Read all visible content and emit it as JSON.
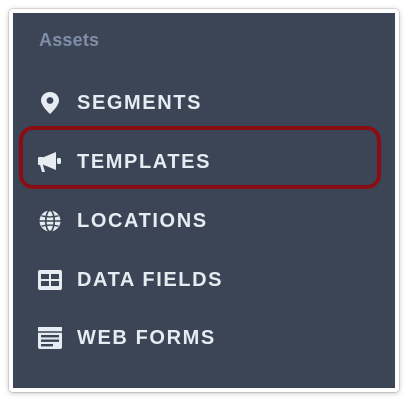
{
  "sidebar": {
    "section_title": "Assets",
    "items": [
      {
        "label": "SEGMENTS",
        "icon": "map-pin-icon"
      },
      {
        "label": "TEMPLATES",
        "icon": "megaphone-icon"
      },
      {
        "label": "LOCATIONS",
        "icon": "globe-icon"
      },
      {
        "label": "DATA FIELDS",
        "icon": "table-icon"
      },
      {
        "label": "WEB FORMS",
        "icon": "form-icon"
      }
    ],
    "highlighted_item": "TEMPLATES"
  },
  "colors": {
    "sidebar_bg": "#3b4555",
    "section_title": "#7f8ea8",
    "item_text": "#e7ebf2",
    "highlight_border": "#8b0d14"
  }
}
